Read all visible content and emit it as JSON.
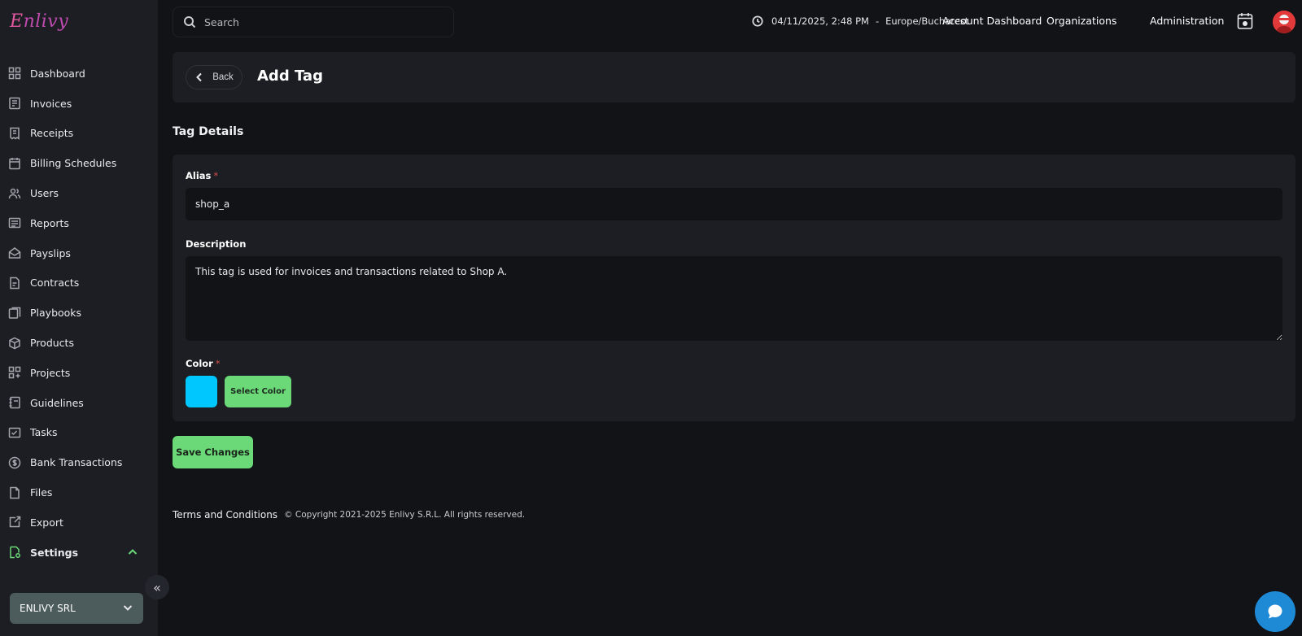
{
  "brand": {
    "logo_text": "Enlivy",
    "accent": "#6bd978",
    "danger": "#d6504a"
  },
  "sidebar": {
    "items": [
      {
        "label": "Dashboard",
        "icon": "dashboard-icon"
      },
      {
        "label": "Invoices",
        "icon": "invoices-icon"
      },
      {
        "label": "Receipts",
        "icon": "receipts-icon"
      },
      {
        "label": "Billing Schedules",
        "icon": "billing-schedules-icon"
      },
      {
        "label": "Users",
        "icon": "users-icon"
      },
      {
        "label": "Reports",
        "icon": "reports-icon"
      },
      {
        "label": "Payslips",
        "icon": "payslips-icon"
      },
      {
        "label": "Contracts",
        "icon": "contracts-icon"
      },
      {
        "label": "Playbooks",
        "icon": "playbooks-icon"
      },
      {
        "label": "Products",
        "icon": "products-icon"
      },
      {
        "label": "Projects",
        "icon": "projects-icon"
      },
      {
        "label": "Guidelines",
        "icon": "guidelines-icon"
      },
      {
        "label": "Tasks",
        "icon": "tasks-icon"
      },
      {
        "label": "Bank Transactions",
        "icon": "bank-transactions-icon"
      },
      {
        "label": "Files",
        "icon": "files-icon"
      },
      {
        "label": "Export",
        "icon": "export-icon"
      },
      {
        "label": "Settings",
        "icon": "settings-icon",
        "expanded": true
      }
    ],
    "org_name": "ENLIVY SRL"
  },
  "topbar": {
    "search_placeholder": "Search",
    "datetime": "04/11/2025, 2:48 PM",
    "separator": "-",
    "timezone": "Europe/Bucharest",
    "nav": [
      "Account Dashboard",
      "Organizations",
      "Administration"
    ]
  },
  "header": {
    "back_label": "Back",
    "title": "Add Tag"
  },
  "section_title": "Tag Details",
  "form": {
    "alias_label": "Alias",
    "alias_value": "shop_a",
    "description_label": "Description",
    "description_value": "This tag is used for invoices and transactions related to Shop A.",
    "color_label": "Color",
    "required_mark": "*",
    "color_value": "#00c8ff",
    "select_color_label": "Select Color"
  },
  "save_label": "Save Changes",
  "footer": {
    "terms": "Terms and Conditions",
    "copyright": "© Copyright 2021-2025 Enlivy S.R.L. All rights reserved."
  }
}
